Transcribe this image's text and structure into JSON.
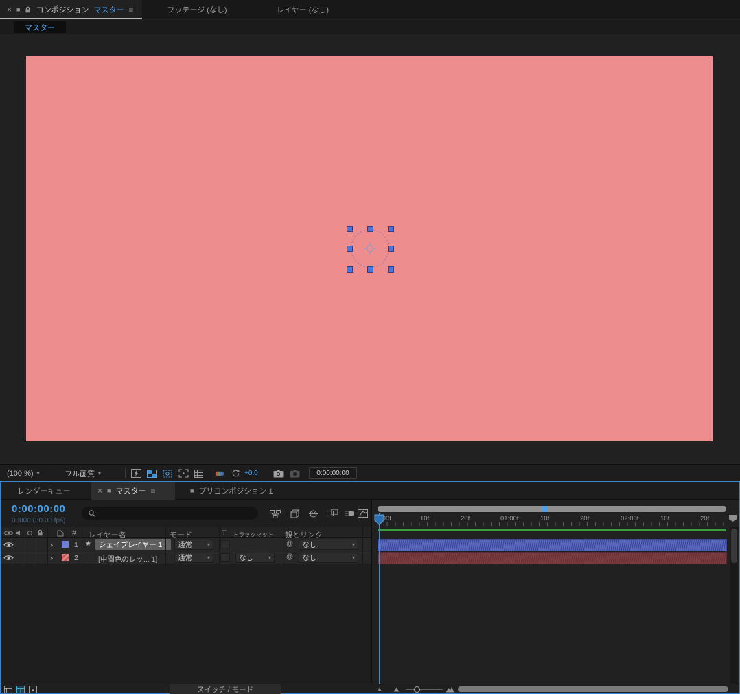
{
  "icons": {
    "close": "×",
    "menu": "≡",
    "panel": "■",
    "dropdown": "▾",
    "expand": "›",
    "star": "★",
    "pick_whip": "@",
    "fit_triangle": "▲"
  },
  "viewer": {
    "tab_composition_label": "コンポジション",
    "tab_composition_comp": "マスター",
    "tab_footage": "フッテージ (なし)",
    "tab_layer": "レイヤー (なし)",
    "breadcrumb": "マスター",
    "toolbar": {
      "zoom_value": "(100 %)",
      "quality_value": "フル画質",
      "exposure_value": "+0.0",
      "timecode": "0:00:00:00"
    }
  },
  "timeline": {
    "tab_render_queue": "レンダーキュー",
    "tab_master": "マスター",
    "tab_precomp": "プリコンポジション 1",
    "current_timecode": "0:00:00:00",
    "frame_info": "00000 (30.00 fps)",
    "columns": {
      "number": "#",
      "layer_name": "レイヤー名",
      "mode": "モード",
      "t": "T",
      "track_matte": "トラックマット",
      "parent_link": "親とリンク"
    },
    "layers": [
      {
        "number": "1",
        "name": "シェイプレイヤー 1",
        "mode": "通常",
        "parent": "なし"
      },
      {
        "number": "2",
        "name": "[中間色のレッ... 1]",
        "mode": "通常",
        "track_matte": "なし",
        "parent": "なし"
      }
    ],
    "ruler_ticks": [
      ":00f",
      "10f",
      "20f",
      "01:00f",
      "10f",
      "20f",
      "02:00f",
      "10f",
      "20f"
    ],
    "footer_switches": "スイッチ / モード"
  },
  "colors": {
    "accent_blue": "#4aa2ec",
    "canvas_salmon": "#ee8d8d",
    "cache_green": "#3f9b3f",
    "layer1_bar": "#5462bf",
    "layer2_bar": "#7c3b40",
    "selection_handle": "#4f74d8",
    "focus_border": "#3d84c8"
  }
}
